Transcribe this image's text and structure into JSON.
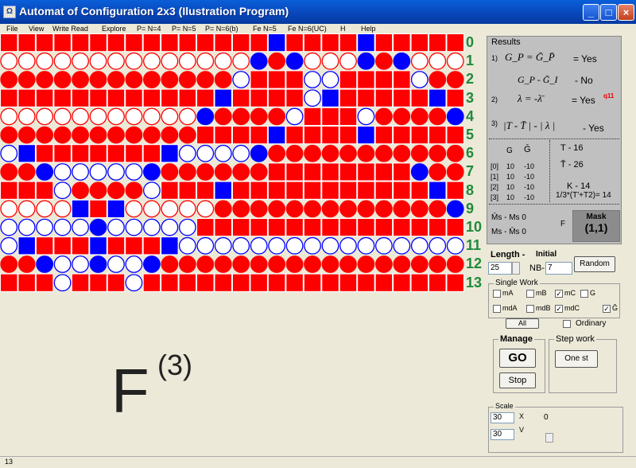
{
  "window": {
    "title": "Automat of Configuration 2x3 (Ilustration Program)",
    "min": "_",
    "max": "□",
    "close": "×"
  },
  "menu": [
    "File",
    "View",
    "Write Read",
    "Explore",
    "P= N=4",
    "P= N=5",
    "P= N=6(b)",
    "Fe N=5",
    "Fe N=6(UC)",
    "H",
    "Help"
  ],
  "grid": {
    "colors": {
      "red": "#ff0000",
      "blue": "#0000ff"
    },
    "rows": [
      "BBBBBBBBBBBBBBBHBBBBHBBBBB",
      "OOOOOOOOOOOOOOCRCOOOCRCOOO",
      "RRRRRRRRRRRRRWBBBWWBBBBWRR",
      "BBBBBBBBBBBBHBBBBWHBBBBBHB",
      "OOOOOOOOOOOCRRRRWBBBWRRRRC",
      "RRRRRRRRRRRBBBBHBBBBHBBBBB",
      "WHBBBBBBBHWWWWCRRRRRRRRRRR",
      "RRCWWWWWCRRRRRRBBBBBBBBCRR",
      "BBBWRRRRWBBBHBBBBBBBBBBBHB",
      "OOOOHBHOOOOORRRRRRRRRRRRRC",
      "WWWWWCWWWWWBBBBBBBBBBBBBBB",
      "WHBBBHBBBHWWWWWWWWWWWWWWWW",
      "RRCWWCWWCRRRRRRRRRRRRRRRRR",
      "BBBWBBBWBBBBBBBBBBBBBBBBBB"
    ]
  },
  "row_labels": [
    "0",
    "1",
    "2",
    "3",
    "4",
    "5",
    "6",
    "7",
    "8",
    "9",
    "10",
    "11",
    "12",
    "13"
  ],
  "results": {
    "title": "Results",
    "r1_num": "1)",
    "r1_formula": "G_P = Ḡ_P̄",
    "r1_answer": "= Yes",
    "r1b_formula": "G_P - Ḡ_I",
    "r1b_answer": "- No",
    "r2_num": "2)",
    "r2_formula": "λ = -λ̄",
    "r2_answer": "= Yes",
    "r2_superscript": "q11",
    "r3_num": "3)",
    "r3_formula": "|T - T̄ | - | λ |",
    "r3_answer": "- Yes",
    "col_g": "G",
    "col_gbar": "Ḡ",
    "t_label": "T - 16",
    "tbar_label": "T̄ - 26",
    "table": [
      {
        "idx": "[0]",
        "g": "10",
        "gbar": "-10"
      },
      {
        "idx": "[1]",
        "g": "10",
        "gbar": "-10"
      },
      {
        "idx": "[2]",
        "g": "10",
        "gbar": "-10"
      },
      {
        "idx": "[3]",
        "g": "10",
        "gbar": "-10"
      }
    ],
    "k_label": "K - 14",
    "formula2": "1/3*(T'+T2)= 14",
    "m1": "M̄s - Ms   0",
    "m2": "Ms - M̄s   0",
    "f_letter": "F"
  },
  "mask": {
    "label": "Mask",
    "value": "(1,1)"
  },
  "length": {
    "label": "Length -",
    "value": "25",
    "initial_label": "Initial",
    "nb_label": "NB-",
    "nb_value": "7",
    "random_button": "Random"
  },
  "single_work": {
    "title": "Single Work",
    "items": [
      {
        "label": "mA",
        "checked": false
      },
      {
        "label": "mB",
        "checked": false
      },
      {
        "label": "mC",
        "checked": true
      },
      {
        "label": "G",
        "checked": false
      },
      {
        "label": "mdA",
        "checked": false
      },
      {
        "label": "mdB",
        "checked": false
      },
      {
        "label": "mdC",
        "checked": true
      },
      {
        "label": "Ḡ",
        "checked": true
      }
    ],
    "all_button": "All",
    "ordinary_label": "Ordinary"
  },
  "manage": {
    "title": "Manage",
    "go_button": "GO",
    "stop_button": "Stop"
  },
  "step_work": {
    "title": "Step work",
    "one_step_button": "One st"
  },
  "scale": {
    "title": "Scale",
    "val1": "30",
    "val2": "30",
    "x_sym": "X",
    "v_sym": "V",
    "zero": "0"
  },
  "big_label": {
    "base": "F",
    "superscript": "(3)"
  },
  "status": {
    "text": "13"
  }
}
